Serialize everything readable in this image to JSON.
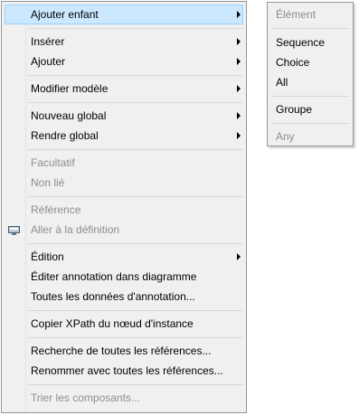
{
  "menu": {
    "items": [
      {
        "label": "Ajouter enfant",
        "has_submenu": true,
        "enabled": true,
        "highlighted": true
      },
      {
        "label": "Insérer",
        "has_submenu": true,
        "enabled": true
      },
      {
        "label": "Ajouter",
        "has_submenu": true,
        "enabled": true
      },
      {
        "label": "Modifier modèle",
        "has_submenu": true,
        "enabled": true
      },
      {
        "label": "Nouveau global",
        "has_submenu": true,
        "enabled": true
      },
      {
        "label": "Rendre global",
        "has_submenu": true,
        "enabled": true
      },
      {
        "label": "Facultatif",
        "enabled": false
      },
      {
        "label": "Non lié",
        "enabled": false
      },
      {
        "label": "Référence",
        "enabled": false
      },
      {
        "label": "Aller à la définition",
        "enabled": false
      },
      {
        "label": "Édition",
        "has_submenu": true,
        "enabled": true
      },
      {
        "label": "Éditer annotation dans diagramme",
        "enabled": true
      },
      {
        "label": "Toutes les données d'annotation...",
        "enabled": true
      },
      {
        "label": "Copier XPath du nœud d'instance",
        "enabled": true
      },
      {
        "label": "Recherche de toutes les références...",
        "enabled": true
      },
      {
        "label": "Renommer avec toutes les références...",
        "enabled": true
      },
      {
        "label": "Trier les composants...",
        "enabled": false
      }
    ]
  },
  "submenu": {
    "items": [
      {
        "label": "Élément",
        "enabled": false
      },
      {
        "label": "Sequence",
        "enabled": true
      },
      {
        "label": "Choice",
        "enabled": true
      },
      {
        "label": "All",
        "enabled": true
      },
      {
        "label": "Groupe",
        "enabled": true
      },
      {
        "label": "Any",
        "enabled": false
      }
    ]
  },
  "icons": {
    "gutter_icon": "schema-component-icon",
    "submenu_arrow": "submenu-arrow-icon"
  },
  "colors": {
    "highlight_background": "#cce8ff",
    "highlight_border": "#99d1ff",
    "disabled_text": "#8d8d8d",
    "menu_background": "#f0f0f0"
  }
}
